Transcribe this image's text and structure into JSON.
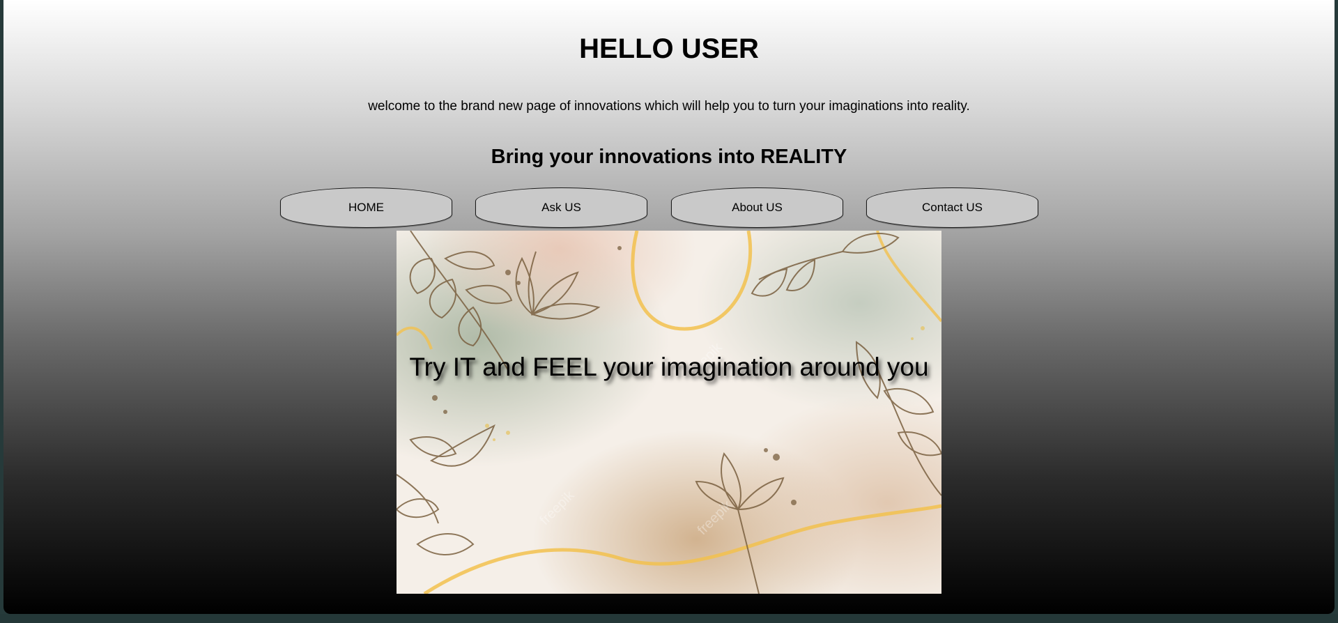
{
  "header": {
    "title": "HELLO USER",
    "intro": "welcome to the brand new page of innovations which will help you to turn your imaginations into reality.",
    "subtitle": "Bring your innovations into REALITY"
  },
  "nav": {
    "items": [
      {
        "label": "HOME"
      },
      {
        "label": "Ask US"
      },
      {
        "label": "About US"
      },
      {
        "label": "Contact US"
      }
    ]
  },
  "hero": {
    "caption": "Try IT and FEEL your imagination around you",
    "watermark": "freepik"
  },
  "colors": {
    "button_bg": "#c9c9c9",
    "leaf_stroke": "#7a6040",
    "gold_line": "#f2c14e"
  }
}
